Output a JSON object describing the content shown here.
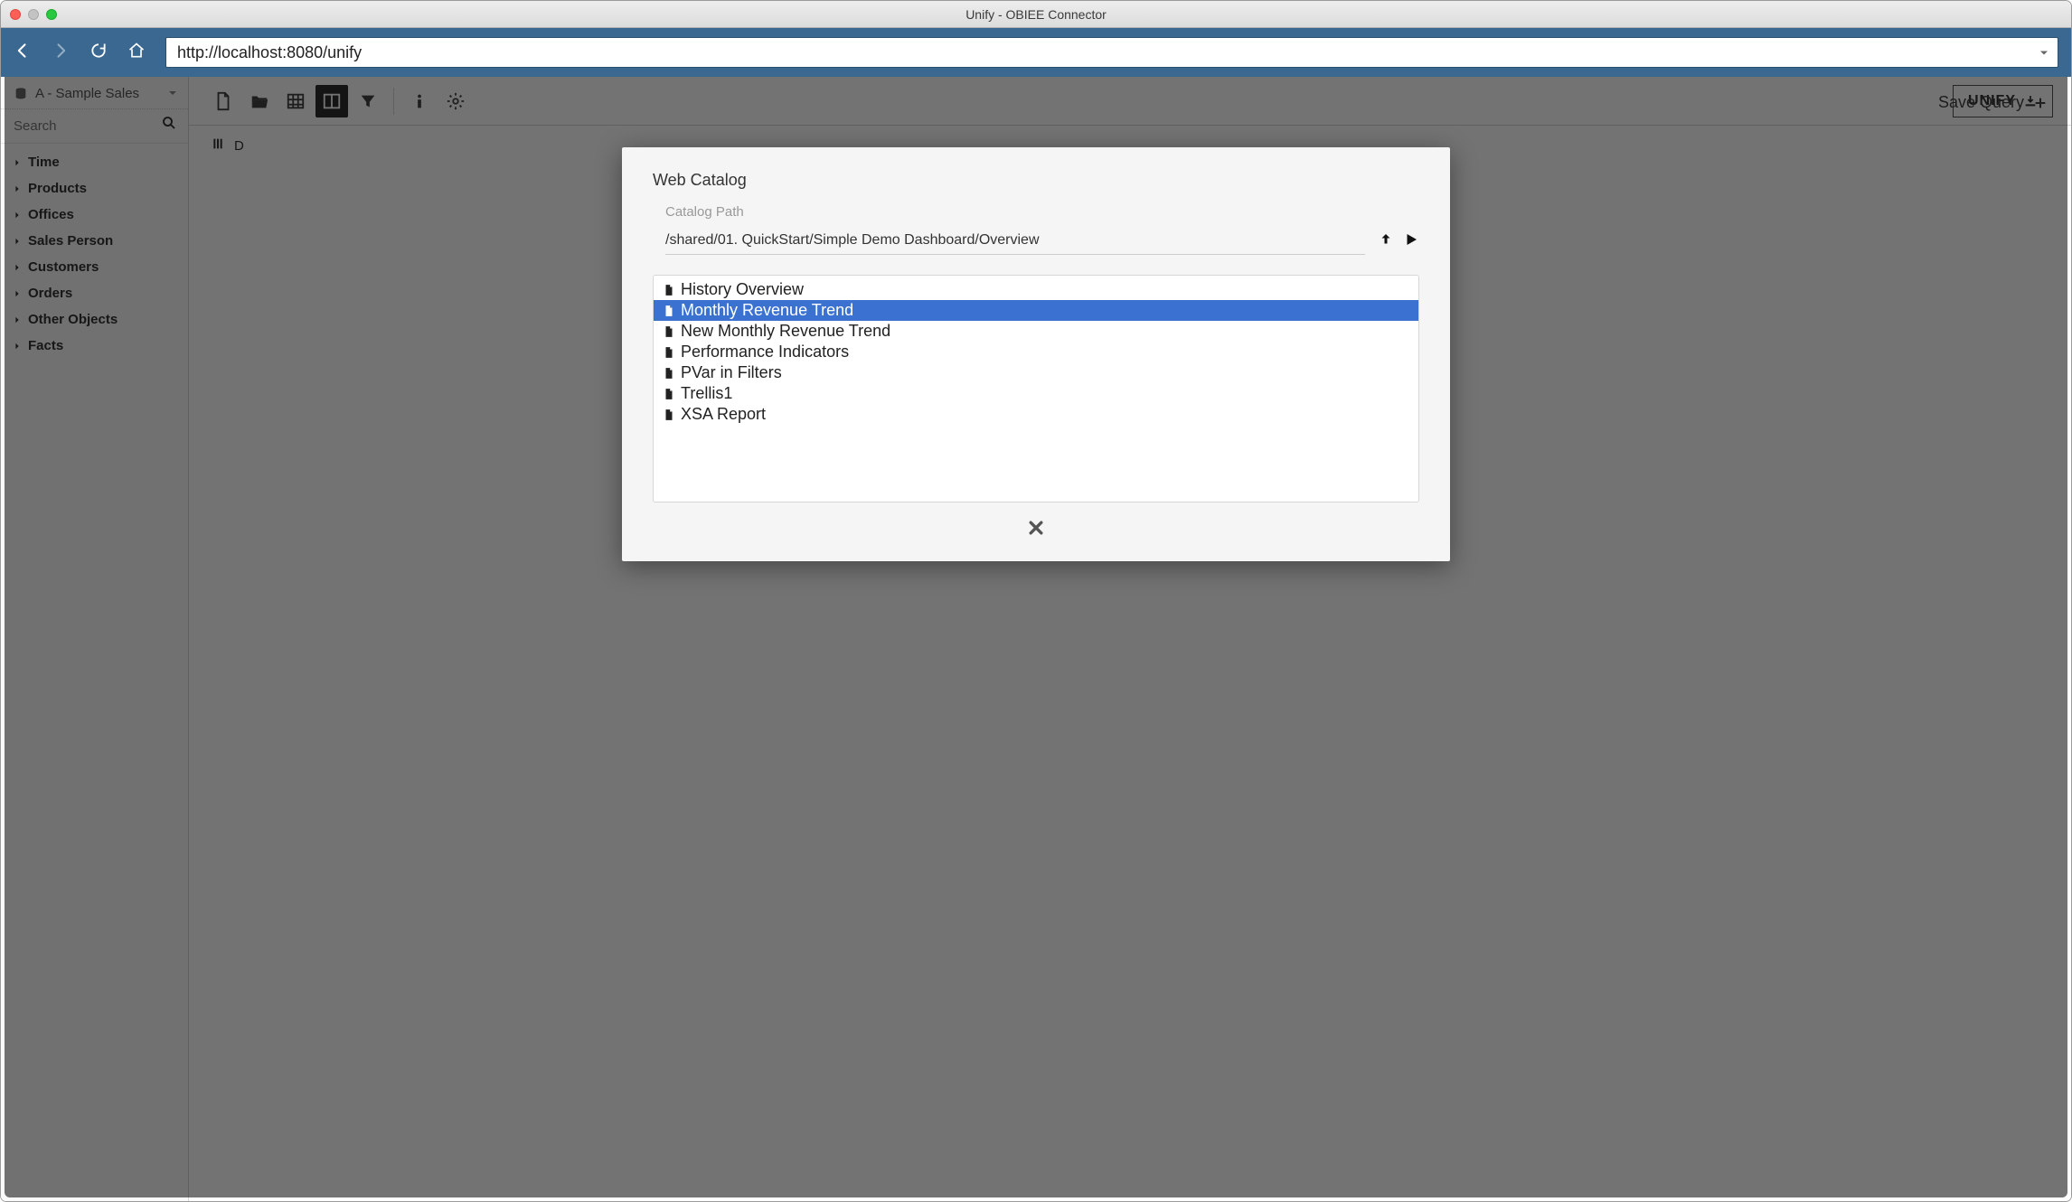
{
  "window": {
    "title": "Unify - OBIEE Connector"
  },
  "browser": {
    "url": "http://localhost:8080/unify"
  },
  "sidebar": {
    "subject_area": "A - Sample Sales",
    "search_placeholder": "Search",
    "tree": [
      "Time",
      "Products",
      "Offices",
      "Sales Person",
      "Customers",
      "Orders",
      "Other Objects",
      "Facts"
    ]
  },
  "toolbar": {
    "unify_label": "UNIFY",
    "save_query_label": "Save Query"
  },
  "content": {
    "drop_hint": "D"
  },
  "modal": {
    "title": "Web Catalog",
    "path_label": "Catalog Path",
    "path_value": "/shared/01. QuickStart/Simple Demo Dashboard/Overview",
    "items": [
      {
        "name": "History Overview",
        "selected": false
      },
      {
        "name": "Monthly Revenue Trend",
        "selected": true
      },
      {
        "name": "New Monthly Revenue Trend",
        "selected": false
      },
      {
        "name": "Performance Indicators",
        "selected": false
      },
      {
        "name": "PVar in Filters",
        "selected": false
      },
      {
        "name": "Trellis1",
        "selected": false
      },
      {
        "name": "XSA Report",
        "selected": false
      }
    ]
  }
}
